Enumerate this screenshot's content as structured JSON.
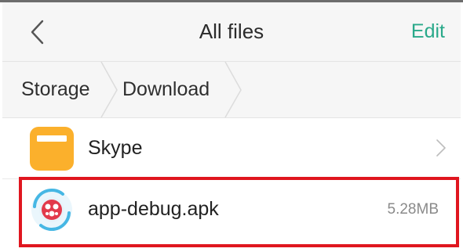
{
  "header": {
    "back_icon": "chevron-left-icon",
    "title": "All files",
    "edit_label": "Edit",
    "accent_color": "#2aa98a"
  },
  "breadcrumb": {
    "items": [
      {
        "label": "Storage"
      },
      {
        "label": "Download"
      }
    ]
  },
  "files": [
    {
      "name": "Skype",
      "kind": "folder",
      "icon": "folder-icon",
      "icon_color": "#fbb02c",
      "chevron_icon": "chevron-right-icon"
    },
    {
      "name": "app-debug.apk",
      "kind": "apk",
      "icon": "apk-icon",
      "size": "5.28MB"
    }
  ],
  "highlight_color": "#e0161f"
}
